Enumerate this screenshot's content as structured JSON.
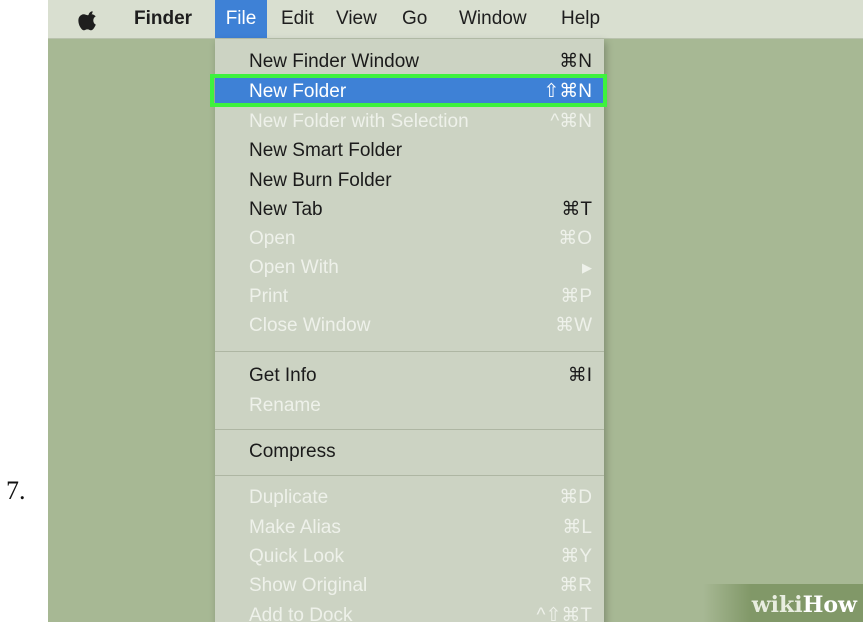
{
  "step_number": "7.",
  "menubar": {
    "apple_icon": "apple-logo-icon",
    "items": [
      "Finder",
      "File",
      "Edit",
      "View",
      "Go",
      "Window",
      "Help"
    ],
    "active_item": "File"
  },
  "file_menu": {
    "items": [
      {
        "label": "New Finder Window",
        "shortcut": "⌘N",
        "enabled": true
      },
      {
        "label": "New Folder",
        "shortcut": "⇧⌘N",
        "enabled": true,
        "highlighted": true
      },
      {
        "label": "New Folder with Selection",
        "shortcut": "^⌘N",
        "enabled": false
      },
      {
        "label": "New Smart Folder",
        "shortcut": "",
        "enabled": true
      },
      {
        "label": "New Burn Folder",
        "shortcut": "",
        "enabled": true
      },
      {
        "label": "New Tab",
        "shortcut": "⌘T",
        "enabled": true
      },
      {
        "label": "Open",
        "shortcut": "⌘O",
        "enabled": false
      },
      {
        "label": "Open With",
        "shortcut": "▶",
        "enabled": false
      },
      {
        "label": "Print",
        "shortcut": "⌘P",
        "enabled": false
      },
      {
        "label": "Close Window",
        "shortcut": "⌘W",
        "enabled": false
      },
      {
        "label": "Get Info",
        "shortcut": "⌘I",
        "enabled": true
      },
      {
        "label": "Rename",
        "shortcut": "",
        "enabled": false
      },
      {
        "label": "Compress",
        "shortcut": "",
        "enabled": true
      },
      {
        "label": "Duplicate",
        "shortcut": "⌘D",
        "enabled": false
      },
      {
        "label": "Make Alias",
        "shortcut": "⌘L",
        "enabled": false
      },
      {
        "label": "Quick Look",
        "shortcut": "⌘Y",
        "enabled": false
      },
      {
        "label": "Show Original",
        "shortcut": "⌘R",
        "enabled": false
      },
      {
        "label": "Add to Dock",
        "shortcut": "^⇧⌘T",
        "enabled": false
      }
    ]
  },
  "watermark": {
    "part1": "wiki",
    "part2": "How"
  },
  "colors": {
    "desktop": "#a7b894",
    "menu_background": "#ccd3c3",
    "selection_blue": "#3e81d6",
    "callout_green": "#3ef23e",
    "disabled_text": "#eef1ea"
  }
}
